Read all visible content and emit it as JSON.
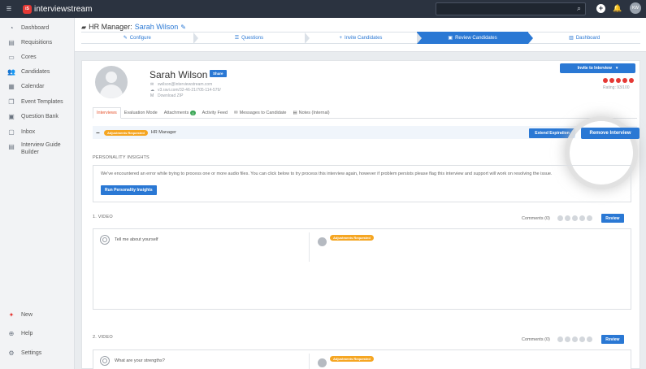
{
  "topbar": {
    "brand": "interviewstream",
    "brand_badge": "iS",
    "icons": {
      "menu": "hamburger-icon",
      "search": "search-icon",
      "add": "plus-icon",
      "notifications": "bell-icon"
    },
    "avatar_initials": "KW"
  },
  "sidebar": {
    "items": [
      {
        "label": "Dashboard",
        "icon": "speedometer-icon",
        "glyph": "◔"
      },
      {
        "label": "Requisitions",
        "icon": "list-icon",
        "glyph": "▤"
      },
      {
        "label": "Cores",
        "icon": "folder-icon",
        "glyph": "▭"
      },
      {
        "label": "Candidates",
        "icon": "users-icon",
        "glyph": "👥"
      },
      {
        "label": "Calendar",
        "icon": "calendar-icon",
        "glyph": "▦"
      },
      {
        "label": "Event Templates",
        "icon": "template-icon",
        "glyph": "❐"
      },
      {
        "label": "Question Bank",
        "icon": "bank-icon",
        "glyph": "▣"
      },
      {
        "label": "Inbox",
        "icon": "inbox-icon",
        "glyph": "▢"
      },
      {
        "label": "Interview Guide Builder",
        "icon": "document-icon",
        "glyph": "▤"
      }
    ],
    "bottom": [
      {
        "label": "New",
        "icon": "sparkle-icon",
        "glyph": "✦"
      },
      {
        "label": "Help",
        "icon": "lifebuoy-icon",
        "glyph": "⊕"
      },
      {
        "label": "Settings",
        "icon": "gear-icon",
        "glyph": "⚙"
      }
    ]
  },
  "header": {
    "job_prefix": "HR Manager:",
    "candidate_link": "Sarah Wilson",
    "steps": [
      {
        "label": "Configure",
        "icon": "wrench-icon",
        "glyph": "✎"
      },
      {
        "label": "Questions",
        "icon": "list-icon",
        "glyph": "☰"
      },
      {
        "label": "Invite Candidates",
        "icon": "plus-icon",
        "glyph": "+"
      },
      {
        "label": "Review Candidates",
        "icon": "monitor-icon",
        "glyph": "▣"
      },
      {
        "label": "Dashboard",
        "icon": "chart-icon",
        "glyph": "▥"
      }
    ],
    "active_step": 3
  },
  "profile": {
    "name": "Sarah Wilson",
    "share_label": "Share",
    "email": "swilson@interviewstream.com",
    "link": "v3.ravi.com/32-46-21/705-114-579/",
    "download": "Download ZIP",
    "invite_label": "Invite to Interview",
    "rating_text": "Rating: 93/100",
    "rating_count": 5
  },
  "tabs": [
    {
      "label": "Interviews",
      "icon": ""
    },
    {
      "label": "Evaluation Mode",
      "icon": ""
    },
    {
      "label": "Attachments",
      "badge": "0"
    },
    {
      "label": "Activity Feed",
      "icon": ""
    },
    {
      "label": "Messages to Candidate",
      "icon": "message-icon",
      "glyph": "✉"
    },
    {
      "label": "Notes (Internal)",
      "icon": "note-icon",
      "glyph": "▤"
    }
  ],
  "status_bar": {
    "collapse": "−",
    "badge": "Adjustments Requested",
    "role": "HR Manager",
    "extend_label": "Extend Expiration",
    "remove_label": "Remove Interview"
  },
  "personality": {
    "title": "PERSONALITY INSIGHTS",
    "message": "We've encountered an error while trying to process one or more audio files. You can click below to try process this interview again, however if problem persists please flag this interview and support will work on resolving the issue.",
    "button": "Run Personality Insights"
  },
  "questions": [
    {
      "title": "1. VIDEO",
      "comments": "Comments (0)",
      "review": "Review",
      "prompt": "Tell me about yourself",
      "badge": "Adjustments Requested"
    },
    {
      "title": "2. VIDEO",
      "comments": "Comments (0)",
      "review": "Review",
      "prompt": "What are your strengths?",
      "badge": "Adjustments Requested"
    }
  ],
  "colors": {
    "accent": "#2a78d4",
    "topbar": "#2b3340",
    "warning": "#f5a623",
    "rating": "#e53935"
  }
}
